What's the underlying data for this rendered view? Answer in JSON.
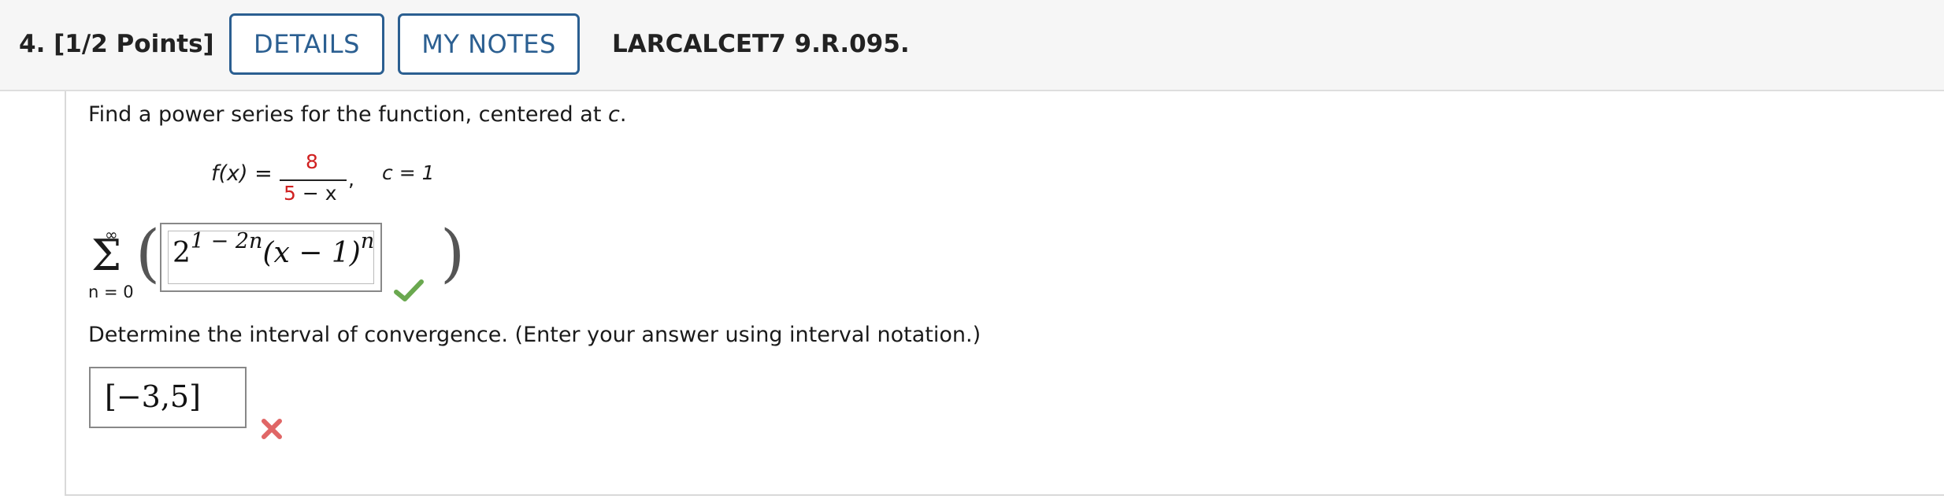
{
  "header": {
    "question_label": "4.  [1/2 Points]",
    "details_label": "DETAILS",
    "notes_label": "MY NOTES",
    "problem_code": "LARCALCET7 9.R.095."
  },
  "problem": {
    "prompt_prefix": "Find a power series for the function, centered at ",
    "prompt_var": "c",
    "prompt_suffix": ".",
    "fx_label": "f(x) =",
    "numerator": "8",
    "denominator_a": "5",
    "denominator_b": " − x",
    "comma": ",",
    "c_value": "c = 1"
  },
  "series": {
    "upper_limit": "∞",
    "sigma": "Σ",
    "lower_limit": "n = 0",
    "answer_base": "2",
    "answer_exponent": "1 − 2n",
    "answer_rest": "(x − 1)",
    "answer_power": "n",
    "status": "correct"
  },
  "interval": {
    "prompt": "Determine the interval of convergence. (Enter your answer using interval notation.)",
    "answer": "[−3,5]",
    "status": "incorrect"
  },
  "colors": {
    "accent": "#2b5f91",
    "red_text": "#d02020",
    "check": "#6aa84f",
    "cross": "#e06666"
  }
}
